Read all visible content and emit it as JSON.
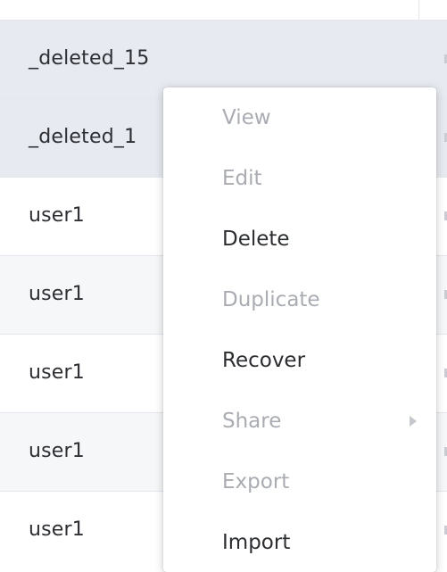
{
  "table": {
    "rows": [
      {
        "name": "_deleted_15",
        "state": "selected"
      },
      {
        "name": "_deleted_1",
        "state": "selected"
      },
      {
        "name": "user1",
        "state": "normal"
      },
      {
        "name": "user1",
        "state": "striped"
      },
      {
        "name": "user1",
        "state": "normal"
      },
      {
        "name": "user1",
        "state": "striped"
      },
      {
        "name": "user1",
        "state": "normal"
      }
    ]
  },
  "context_menu": {
    "items": [
      {
        "label": "View",
        "enabled": false
      },
      {
        "label": "Edit",
        "enabled": false
      },
      {
        "label": "Delete",
        "enabled": true
      },
      {
        "label": "Duplicate",
        "enabled": false
      },
      {
        "label": "Recover",
        "enabled": true
      },
      {
        "label": "Share",
        "enabled": false,
        "submenu": true
      },
      {
        "label": "Export",
        "enabled": false
      },
      {
        "label": "Import",
        "enabled": true
      }
    ]
  },
  "colors": {
    "selected_row_bg": "#e7eaf0",
    "striped_row_bg": "#f6f7f8",
    "enabled_text": "#2b2d31",
    "disabled_text": "#a9acb2"
  }
}
